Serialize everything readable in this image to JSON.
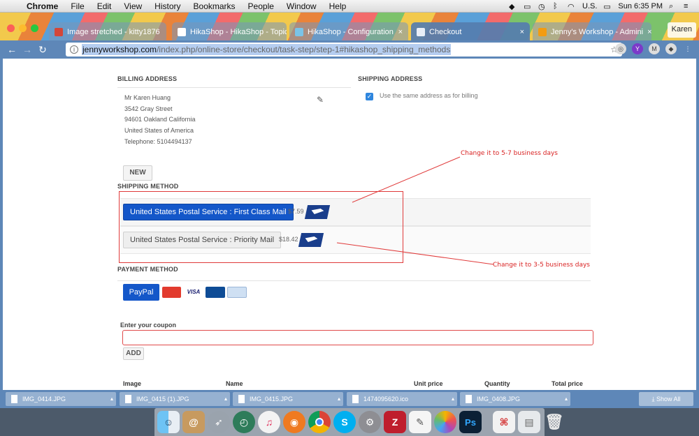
{
  "menubar": {
    "app": "Chrome",
    "items": [
      "File",
      "Edit",
      "View",
      "History",
      "Bookmarks",
      "People",
      "Window",
      "Help"
    ],
    "input_source": "U.S.",
    "clock": "Sun 6:35 PM"
  },
  "tabs": [
    {
      "title": "Image stretched - kitty1876"
    },
    {
      "title": "HikaShop - HikaShop - Topic"
    },
    {
      "title": "HikaShop - Configuration"
    },
    {
      "title": "Checkout"
    },
    {
      "title": "Jenny's Workshop - Admini"
    }
  ],
  "profile_name": "Karen",
  "address_bar": {
    "domain": "jennyworkshop.com",
    "path": "/index.php/online-store/checkout/task-step/step-1#hikashop_shipping_methods"
  },
  "billing": {
    "title": "BILLING ADDRESS",
    "lines": [
      "Mr Karen Huang",
      "3542 Gray Street",
      "94601 Oakland California",
      "United States of America",
      "Telephone: 5104494137"
    ],
    "new_label": "NEW"
  },
  "shipping_address": {
    "title": "SHIPPING ADDRESS",
    "same_label": "Use the same address as for billing"
  },
  "shipping_method": {
    "title": "SHIPPING METHOD",
    "options": [
      {
        "label": "United States Postal Service : First Class Mail",
        "price": "$7.59",
        "selected": true
      },
      {
        "label": "United States Postal Service : Priority Mail",
        "price": "$18.42",
        "selected": false
      }
    ]
  },
  "annotations": {
    "first": "Change it to 5-7 business days",
    "second": "Change it to 3-5 business days"
  },
  "payment": {
    "title": "PAYMENT METHOD",
    "paypal_label": "PayPal",
    "cards": [
      "MasterCard",
      "VISA",
      "JCB",
      "PayPal"
    ]
  },
  "coupon": {
    "label": "Enter your coupon",
    "add_label": "ADD"
  },
  "cart_table": {
    "headers": [
      "Image",
      "Name",
      "Unit price",
      "Quantity",
      "Total price"
    ]
  },
  "downloads": {
    "files": [
      "IMG_0414.JPG",
      "IMG_0415 (1).JPG",
      "IMG_0415.JPG",
      "1474095620.ico",
      "IMG_0408.JPG"
    ],
    "show_all": "Show All"
  },
  "dock_apps": [
    "Finder",
    "Contacts",
    "Launchpad",
    "Time Machine",
    "iTunes",
    "Firefox",
    "Chrome",
    "Skype",
    "System Preferences",
    "FileZilla",
    "TextEdit",
    "Photos",
    "Photoshop",
    "PDF",
    "Trash"
  ],
  "colors": {
    "primary_button": "#1457c9",
    "annotation_red": "#d92323",
    "chrome_blue": "#5e87b8"
  }
}
